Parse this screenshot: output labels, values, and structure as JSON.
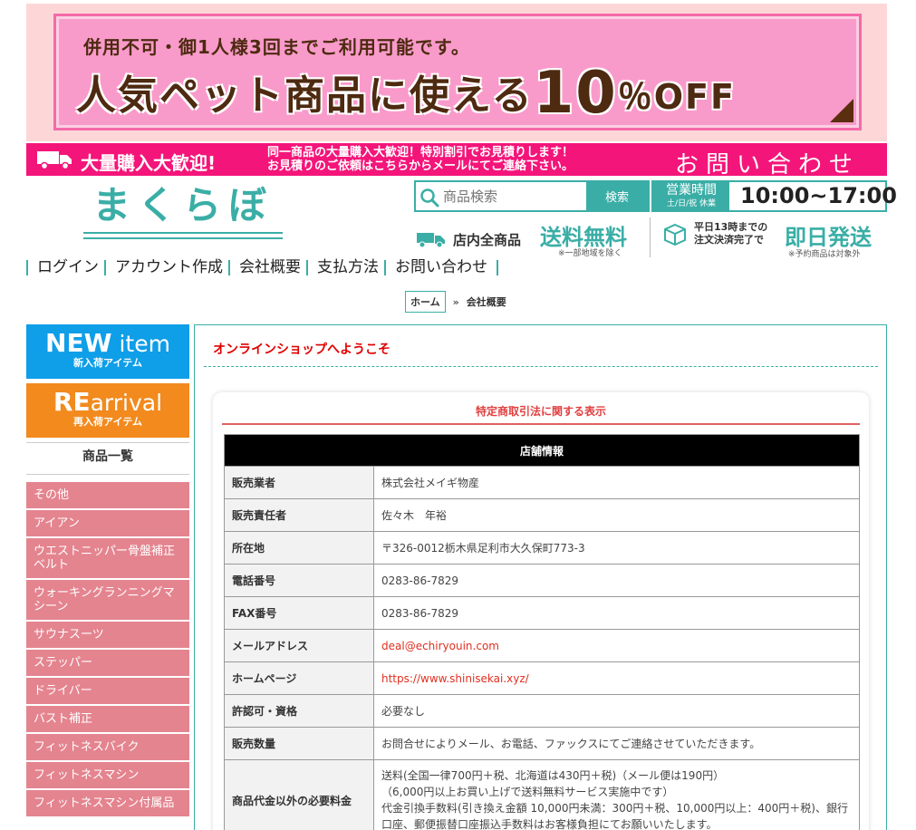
{
  "promo": {
    "line1": "併用不可・御1人様3回までご利用可能です。",
    "line2_prefix": "人気ペット商品に使える",
    "line2_number": "10",
    "line2_percent": "％OFF"
  },
  "bulk_bar": {
    "title": "大量購入大歓迎!",
    "desc_line1": "同一商品の大量購入大歓迎！特別割引でお見積りします！",
    "desc_line2": "お見積りのご依頼はこちらからメールにてご連絡下さい。",
    "contact": "お問い合わせ"
  },
  "header": {
    "logo": "まくらぼ",
    "search_placeholder": "商品検索",
    "search_button": "検索",
    "hours_title": "営業時間",
    "hours_closed": "土/日/祝 休業",
    "hours_value": "10:00~17:00",
    "ship_all": "店内全商品",
    "ship_free": "送料無料",
    "ship_note": "※一部地域を除く",
    "same_day_desc1": "平日13時までの",
    "same_day_desc2": "注文決済完了で",
    "same_day_title": "即日発送",
    "same_day_note": "※予約商品は対象外"
  },
  "nav": {
    "items": [
      "ログイン",
      "アカウント作成",
      "会社概要",
      "支払方法",
      "お問い合わせ"
    ]
  },
  "breadcrumb": {
    "home": "ホーム",
    "sep": "»",
    "current": "会社概要"
  },
  "sidebar": {
    "new_main": "NEW",
    "new_main2": "item",
    "new_sub": "新入荷アイテム",
    "re_main": "RE",
    "re_main2": "arrival",
    "re_sub": "再入荷アイテム",
    "list_title": "商品一覧",
    "categories": [
      "その他",
      "アイアン",
      "ウエストニッパー骨盤補正ベルト",
      "ウォーキングランニングマシーン",
      "サウナスーツ",
      "ステッパー",
      "ドライバー",
      "バスト補正",
      "フィットネスバイク",
      "フィットネスマシン",
      "フィットネスマシン付属品"
    ]
  },
  "main": {
    "welcome": "オンラインショップへようこそ",
    "card_title": "特定商取引法に関する表示",
    "table_header": "店舗情報",
    "rows": [
      {
        "key": "販売業者",
        "value": "株式会社メイギ物産"
      },
      {
        "key": "販売責任者",
        "value": "佐々木　年裕"
      },
      {
        "key": "所在地",
        "value": "〒326-0012栃木県足利市大久保町773-3"
      },
      {
        "key": "電話番号",
        "value": "0283-86-7829"
      },
      {
        "key": "FAX番号",
        "value": "0283-86-7829"
      },
      {
        "key": "メールアドレス",
        "value": "deal@echiryouin.com"
      },
      {
        "key": "ホームページ",
        "value": "https://www.shinisekai.xyz/"
      },
      {
        "key": "許認可・資格",
        "value": "必要なし"
      },
      {
        "key": "販売数量",
        "value": "お問合せによりメール、お電話、ファックスにてご連絡させていただきます。"
      },
      {
        "key": "商品代金以外の必要料金",
        "value_lines": [
          "送料(全国一律700円＋税、北海道は430円＋税)（メール便は190円）",
          "（6,000円以上お買い上げで送料無料サービス実施中です）",
          "代金引換手数料(引き換え金額 10,000円未満：300円＋税、10,000円以上：400円＋税)、銀行",
          "口座、郵便振替口座振込手数料はお客様負担にてお願いいたします。"
        ]
      }
    ]
  },
  "colors": {
    "teal": "#3aaea6",
    "pink_bar": "#f4157a",
    "sidebar_item": "#e4848f",
    "promo_bg": "#f99bca"
  }
}
